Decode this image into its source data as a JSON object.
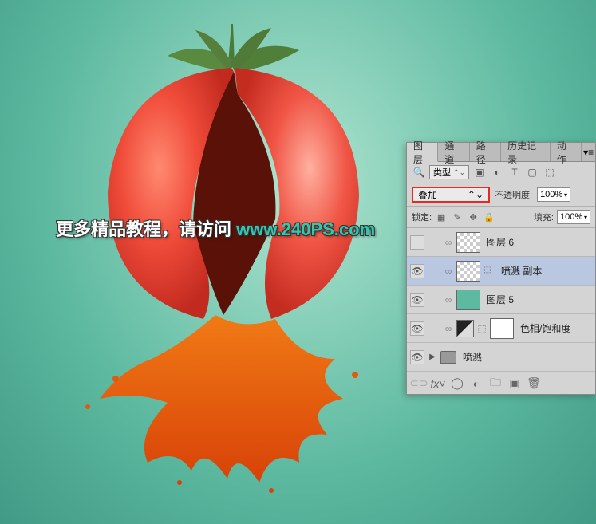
{
  "watermark": {
    "text": "更多精品教程，请访问 ",
    "url": "www.240PS.com"
  },
  "panel": {
    "tabs": [
      "图层",
      "通道",
      "路径",
      "历史记录",
      "动作"
    ],
    "active_tab": 0,
    "filter": {
      "kind_label": "类型",
      "icons": [
        "image",
        "adjust",
        "text",
        "shape",
        "smart"
      ]
    },
    "blend": {
      "mode": "叠加",
      "opacity_label": "不透明度:",
      "opacity_value": "100%"
    },
    "lock": {
      "label": "锁定:",
      "fill_label": "填充:",
      "fill_value": "100%"
    },
    "layers": [
      {
        "visible": false,
        "thumb": "checker",
        "name": "图层 6",
        "indent": 1
      },
      {
        "visible": true,
        "thumb": "checker",
        "name": "喷溅 副本",
        "selected": true,
        "smart": true,
        "indent": 1
      },
      {
        "visible": true,
        "thumb": "blue",
        "name": "图层 5",
        "indent": 1
      },
      {
        "visible": true,
        "thumb": "adj",
        "mask": true,
        "name": "色相/饱和度",
        "indent": 1
      },
      {
        "visible": true,
        "thumb": "folder",
        "name": "喷溅",
        "disclosure": true,
        "indent": 0
      }
    ],
    "footer_icons": [
      "link",
      "fx",
      "mask",
      "adjust",
      "group",
      "new",
      "trash"
    ]
  }
}
